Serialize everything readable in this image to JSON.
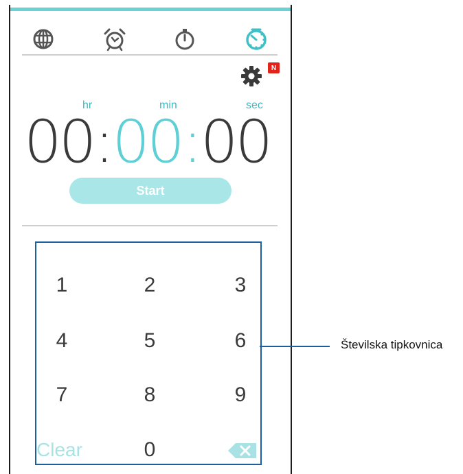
{
  "tabs": [
    {
      "name": "world-clock",
      "icon": "globe-icon",
      "active": false
    },
    {
      "name": "alarm",
      "icon": "alarm-clock-icon",
      "active": false
    },
    {
      "name": "stopwatch",
      "icon": "stopwatch-icon",
      "active": false
    },
    {
      "name": "timer",
      "icon": "timer-icon",
      "active": true
    }
  ],
  "settings": {
    "icon": "gear-icon",
    "badge": "N"
  },
  "timer": {
    "units": {
      "hr": "hr",
      "min": "min",
      "sec": "sec"
    },
    "hours": "00",
    "minutes": "00",
    "seconds": "00",
    "separator": ":"
  },
  "start_button": {
    "label": "Start"
  },
  "keypad": {
    "keys": [
      "1",
      "2",
      "3",
      "4",
      "5",
      "6",
      "7",
      "8",
      "9"
    ],
    "clear_label": "Clear",
    "zero": "0",
    "backspace_icon": "backspace-icon"
  },
  "callout": {
    "label": "Številska tipkovnica"
  },
  "colors": {
    "accent": "#5ecfd5",
    "accent_light": "#a8e6e8",
    "digits": "#3a3a3a",
    "callout": "#1c5fa0"
  }
}
